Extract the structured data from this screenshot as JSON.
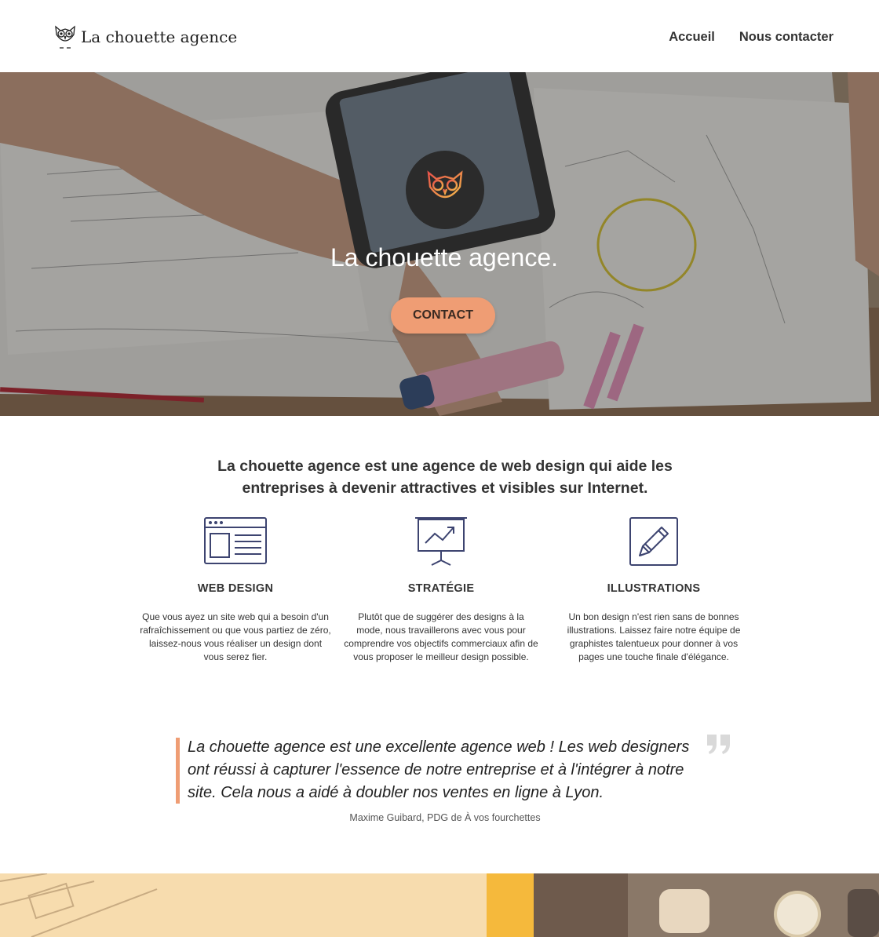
{
  "header": {
    "logo_text": "La chouette agence",
    "nav": [
      {
        "label": "Accueil"
      },
      {
        "label": "Nous contacter"
      }
    ]
  },
  "hero": {
    "title": "La chouette agence.",
    "button_label": "CONTACT",
    "accent_color": "#ef9d74"
  },
  "intro": {
    "text": "La chouette agence est une agence de web design qui aide les entreprises à devenir attractives et visibles sur Internet."
  },
  "services": [
    {
      "icon": "web-design-icon",
      "title": "WEB DESIGN",
      "description": "Que vous ayez un site web qui a besoin d'un rafraîchissement ou que vous partiez de zéro, laissez-nous vous réaliser un design dont vous serez fier."
    },
    {
      "icon": "strategy-chart-icon",
      "title": "STRATÉGIE",
      "description": "Plutôt que de suggérer des designs à la mode, nous travaillerons avec vous pour comprendre vos objectifs commerciaux afin de vous proposer le meilleur design possible."
    },
    {
      "icon": "pencil-icon",
      "title": "ILLUSTRATIONS",
      "description": "Un bon design n'est rien sans de bonnes illustrations. Laissez faire notre équipe de graphistes talentueux pour donner à vos pages une touche finale d'élégance."
    }
  ],
  "testimonial": {
    "quote": "La chouette agence est une excellente agence web ! Les web designers ont réussi à capturer l'essence de notre entreprise et à l'intégrer à notre site. Cela nous a aidé à doubler nos ventes en ligne à Lyon.",
    "author": "Maxime Guibard, PDG de À vos fourchettes"
  }
}
